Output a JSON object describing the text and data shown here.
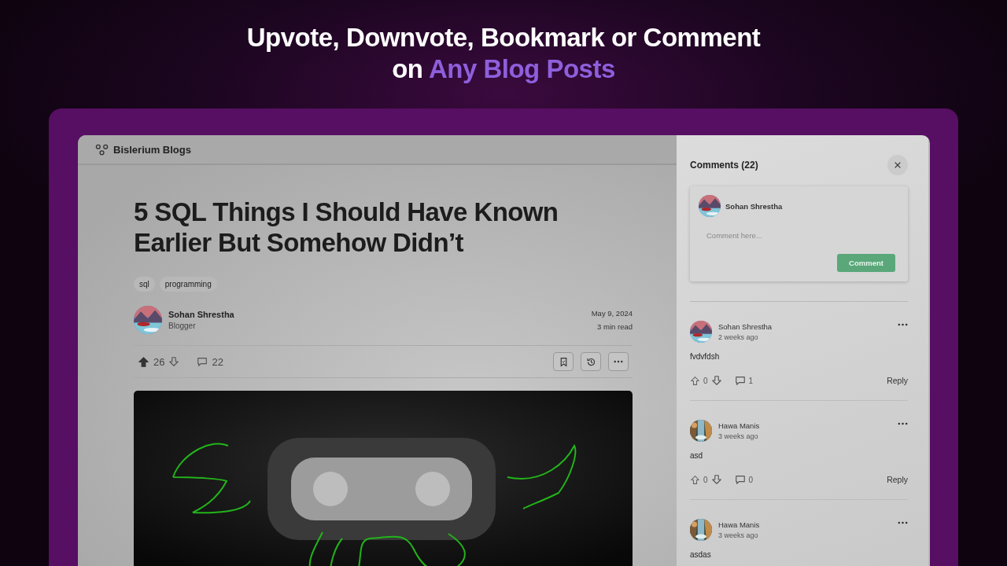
{
  "headline": {
    "line_1": "Upvote, Downvote, Bookmark or Comment",
    "line_2": [
      {
        "text": "on ",
        "highlight": false
      },
      {
        "text": "Any Blog Posts",
        "highlight": true
      }
    ]
  },
  "site": {
    "name": "Bislerium Blogs"
  },
  "post": {
    "title": "5 SQL Things I Should Have Known Earlier But Somehow Didn’t",
    "tags": [
      "sql",
      "programming"
    ],
    "author": {
      "name": "Sohan Shrestha",
      "role": "Blogger"
    },
    "date": "May 9, 2024",
    "read_time": "3 min read",
    "upvoted": true,
    "votes": "26",
    "comment_count": "22",
    "cover": {
      "kind": "picture"
    }
  },
  "comments_panel": {
    "title": "Comments (22)",
    "composer": {
      "user": "Sohan Shrestha",
      "placeholder": "Comment here...",
      "button": "Comment"
    },
    "comments": [
      {
        "author": "Sohan Shrestha",
        "time": "2 weeks ago",
        "text": "fvdvfdsh",
        "votes": "0",
        "replies": "1",
        "reply": "Reply",
        "upvoted": false
      },
      {
        "author": "Hawa Manis",
        "time": "3 weeks ago",
        "text": "asd",
        "votes": "0",
        "replies": "0",
        "reply": "Reply",
        "upvoted": false
      },
      {
        "author": "Hawa Manis",
        "time": "3 weeks ago",
        "text": "asdas"
      }
    ]
  }
}
